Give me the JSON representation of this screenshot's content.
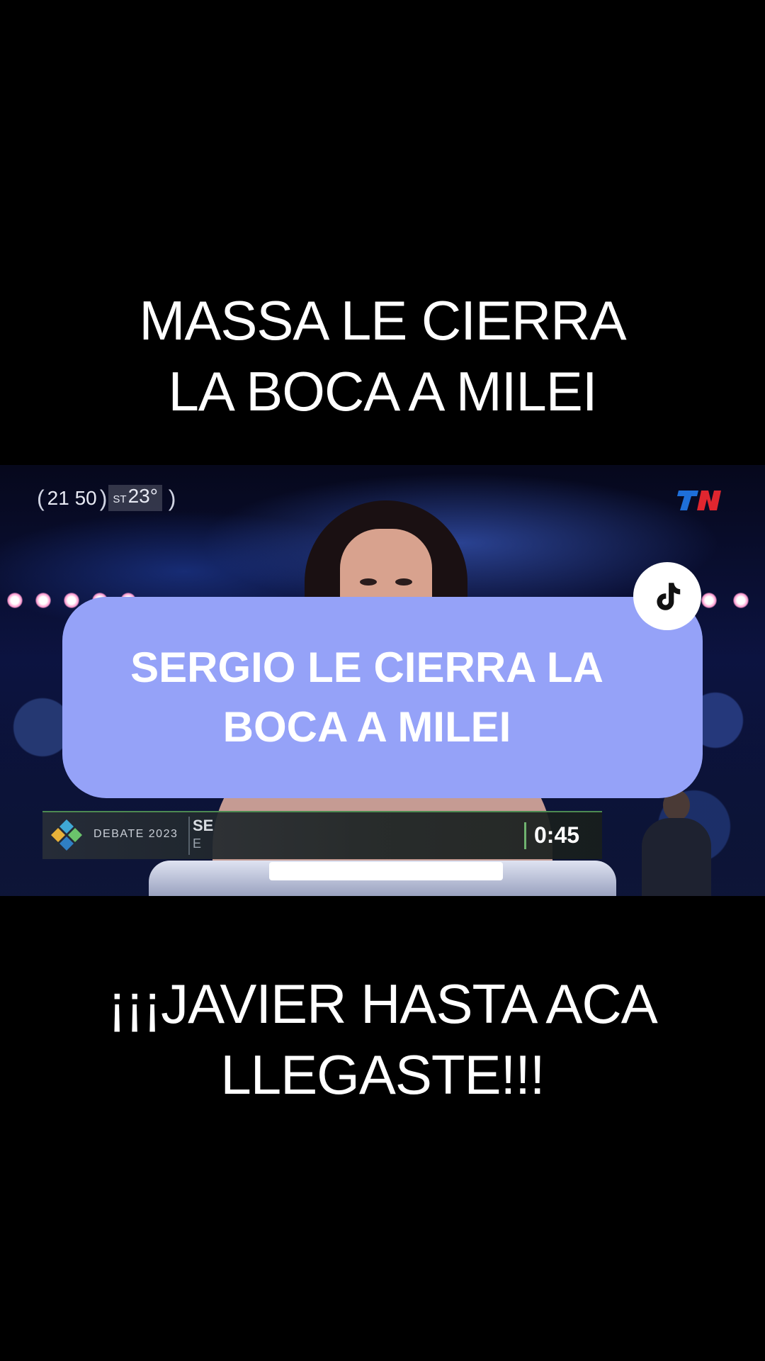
{
  "top_caption": {
    "line1": "MASSA LE CIERRA",
    "line2": "LA BOCA A MILEI"
  },
  "video": {
    "time": "21 50",
    "temp_prefix": "ST",
    "temperature": "23°",
    "channel_logo": "TN",
    "lower_third": {
      "program_label": "DEBATE 2023",
      "speaker_name_truncated": "SE",
      "speaker_sub_truncated": "E",
      "timer": "0:45"
    }
  },
  "caption_bubble": {
    "line1": "SERGIO LE CIERRA LA",
    "line2": "BOCA A MILEI"
  },
  "bottom_caption": {
    "line1": "¡¡¡JAVIER HASTA ACA",
    "line2": "LLEGASTE!!!"
  },
  "icons": {
    "tiktok": "tiktok-icon",
    "channel": "tn-logo-icon",
    "debate": "debate-logo-icon"
  },
  "colors": {
    "bubble": "#95a2f8",
    "background": "#000000",
    "timer_bar": "#6fb36f",
    "tn_blue": "#1e6fd9",
    "tn_red": "#e0262f"
  }
}
